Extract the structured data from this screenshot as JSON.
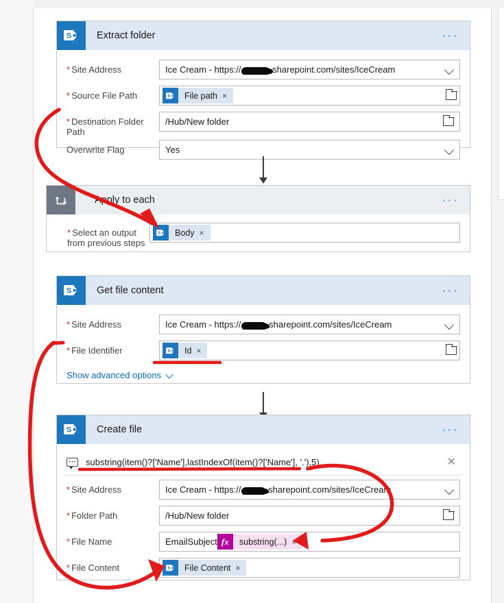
{
  "app": {
    "name": "Power Automate flow designer",
    "accent_blue": "#1e76bd",
    "header_blue": "#dde8f4",
    "loop_gray": "#6d7884",
    "token_blue": "#dbe5f1",
    "fx_magenta": "#b4009e",
    "required_red": "#d13438",
    "link_blue": "#0a6cbf",
    "annotation_red": "#e01b1b"
  },
  "icons": {
    "sharepoint": "sharepoint-icon",
    "loop": "apply-to-each-loop-icon",
    "more": "more-options-ellipsis-icon",
    "chevron_down": "chevron-down-icon",
    "folder_picker": "folder-picker-icon",
    "expression": "expression-editor-icon",
    "close": "close-icon",
    "fx": "fx"
  },
  "cards": [
    {
      "id": "extract-folder",
      "title": "Extract folder",
      "type": "sharepoint",
      "more_label": "···",
      "fields": [
        {
          "name": "site-address",
          "label": "Site Address",
          "required": true,
          "control": "dropdown",
          "value_prefix": "Ice Cream - https://",
          "value_suffix": ".sharepoint.com/sites/IceCream",
          "redacted": true
        },
        {
          "name": "source-file-path",
          "label": "Source File Path",
          "required": true,
          "control": "token",
          "token": {
            "label": "File path",
            "icon": "sharepoint",
            "remove": "×"
          },
          "picker": "folder"
        },
        {
          "name": "destination-folder-path",
          "label": "Destination Folder\nPath",
          "required": true,
          "control": "text",
          "value": "/Hub/New folder",
          "picker": "folder"
        },
        {
          "name": "overwrite-flag",
          "label": "Overwrite Flag",
          "required": false,
          "control": "dropdown",
          "value": "Yes"
        }
      ]
    },
    {
      "id": "apply-to-each",
      "title": "Apply to each",
      "type": "loop",
      "more_label": "···",
      "fields": [
        {
          "name": "select-an-output",
          "label": "Select an output\nfrom previous steps",
          "required": true,
          "control": "token",
          "token": {
            "label": "Body",
            "icon": "sharepoint",
            "remove": "×"
          }
        }
      ]
    },
    {
      "id": "get-file-content",
      "title": "Get file content",
      "type": "sharepoint",
      "more_label": "···",
      "fields": [
        {
          "name": "site-address",
          "label": "Site Address",
          "required": true,
          "control": "dropdown",
          "value_prefix": "Ice Cream - https://",
          "value_suffix": ".sharepoint.com/sites/IceCream",
          "redacted": true
        },
        {
          "name": "file-identifier",
          "label": "File Identifier",
          "required": true,
          "control": "token",
          "token": {
            "label": "Id",
            "icon": "sharepoint",
            "remove": "×"
          },
          "picker": "folder"
        }
      ],
      "advanced_options_label": "Show advanced options"
    },
    {
      "id": "create-file",
      "title": "Create file",
      "type": "sharepoint",
      "more_label": "···",
      "expression": {
        "name": "expression-bar",
        "text": "substring(item()?['Name'],lastIndexOf(item()?['Name'], '.'),5)",
        "close": "✕"
      },
      "fields": [
        {
          "name": "site-address",
          "label": "Site Address",
          "required": true,
          "control": "dropdown",
          "value_prefix": "Ice Cream - https://",
          "value_suffix": ".sharepoint.com/sites/IceCream",
          "redacted": true
        },
        {
          "name": "folder-path",
          "label": "Folder Path",
          "required": true,
          "control": "text",
          "value": "/Hub/New folder",
          "picker": "folder"
        },
        {
          "name": "file-name",
          "label": "File Name",
          "required": true,
          "control": "text-plus-fx",
          "value": "EmailSubject",
          "token": {
            "label": "substring(...)",
            "icon": "fx",
            "remove": "×"
          }
        },
        {
          "name": "file-content",
          "label": "File Content",
          "required": true,
          "control": "token",
          "token": {
            "label": "File Content",
            "icon": "sharepoint",
            "remove": "×"
          }
        }
      ]
    }
  ],
  "annotations": [
    {
      "name": "arrow-destination-to-body",
      "kind": "curved-arrow"
    },
    {
      "name": "underline-under-show-advanced-options",
      "kind": "underline"
    },
    {
      "name": "underline-under-expression",
      "kind": "underline"
    },
    {
      "name": "arrow-expression-to-substring-chip",
      "kind": "curved-arrow"
    },
    {
      "name": "arrow-file-identifier-to-file-content",
      "kind": "long-curved-arrow"
    },
    {
      "name": "tick-file-identifier",
      "kind": "tick"
    }
  ]
}
